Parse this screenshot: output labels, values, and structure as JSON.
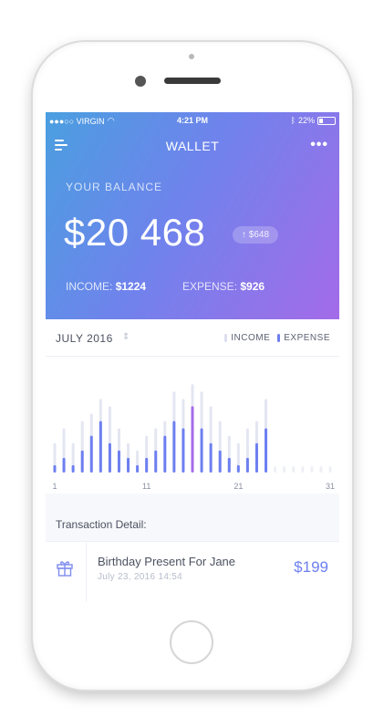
{
  "status_bar": {
    "carrier": "●●●○○ VIRGIN",
    "time": "4:21 PM",
    "battery": "22%"
  },
  "nav": {
    "title": "WALLET"
  },
  "balance": {
    "label": "YOUR BALANCE",
    "value": "$20 468",
    "change": "↑ $648",
    "income_label": "INCOME:",
    "income_value": "$1224",
    "expense_label": "EXPENSE:",
    "expense_value": "$926"
  },
  "period": {
    "month": "JULY 2016",
    "caret": "⇕"
  },
  "legend": {
    "income": "INCOME",
    "expense": "EXPENSE",
    "income_color": "#dcdfee",
    "expense_color": "#6d7ff0"
  },
  "colors": {
    "accent": "#6d7ff0",
    "highlight": "#a46be9",
    "gradient_start": "#4a9fe0",
    "gradient_end": "#a46be9"
  },
  "chart_data": {
    "type": "bar",
    "x": [
      1,
      2,
      3,
      4,
      5,
      6,
      7,
      8,
      9,
      10,
      11,
      12,
      13,
      14,
      15,
      16,
      17,
      18,
      19,
      20,
      21,
      22,
      23,
      24,
      25,
      26,
      27,
      28,
      29,
      30,
      31
    ],
    "xticks": [
      "1",
      "11",
      "21",
      "31"
    ],
    "series": [
      {
        "name": "INCOME",
        "values": [
          4,
          6,
          4,
          7,
          8,
          10,
          9,
          6,
          4,
          3,
          5,
          6,
          7,
          11,
          10,
          12,
          11,
          9,
          7,
          5,
          4,
          6,
          7,
          10,
          0,
          0,
          0,
          0,
          0,
          0,
          0
        ]
      },
      {
        "name": "EXPENSE",
        "values": [
          1,
          2,
          1,
          3,
          5,
          7,
          4,
          3,
          2,
          1,
          2,
          3,
          5,
          7,
          6,
          9,
          6,
          4,
          3,
          2,
          1,
          2,
          4,
          6,
          0,
          0,
          0,
          0,
          0,
          0,
          0
        ]
      }
    ],
    "highlight_day": 16,
    "ylim": [
      0,
      13
    ]
  },
  "transactions": {
    "title": "Transaction Detail:",
    "items": [
      {
        "name": "Birthday Present For Jane",
        "date": "July 23, 2016   14:54",
        "amount": "$199"
      }
    ]
  }
}
